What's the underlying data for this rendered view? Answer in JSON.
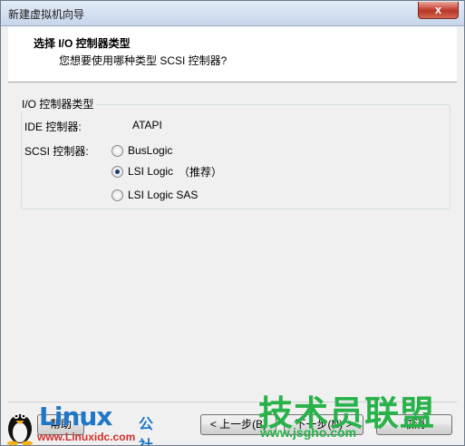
{
  "window": {
    "title": "新建虚拟机向导",
    "close_glyph": "x"
  },
  "header": {
    "title": "选择 I/O 控制器类型",
    "subtitle": "您想要使用哪种类型 SCSI 控制器?"
  },
  "group": {
    "legend": "I/O 控制器类型",
    "ide_label": "IDE 控制器:",
    "ide_value": "ATAPI",
    "scsi_label": "SCSI 控制器:",
    "options": [
      {
        "label": "BusLogic",
        "checked": false
      },
      {
        "label": "LSI Logic",
        "checked": true,
        "note": "（推荐）"
      },
      {
        "label": "LSI Logic SAS",
        "checked": false
      }
    ]
  },
  "buttons": {
    "help": "帮助",
    "back": "< 上一步(B)",
    "next": "下一步(N) >",
    "cancel": "取消"
  },
  "watermarks": {
    "left_brand": "Linux",
    "left_brand_suffix": "公社",
    "left_url": "www.Linuxidc.com",
    "right_brand": "技术员联盟",
    "right_url": "www.jsgho.com"
  },
  "colors": {
    "title_gradient": "#c5d5ea",
    "close_red": "#c8473a",
    "linux_blue": "#1f77c8",
    "url_red": "#d0312d",
    "wm_green": "#28b24a"
  }
}
